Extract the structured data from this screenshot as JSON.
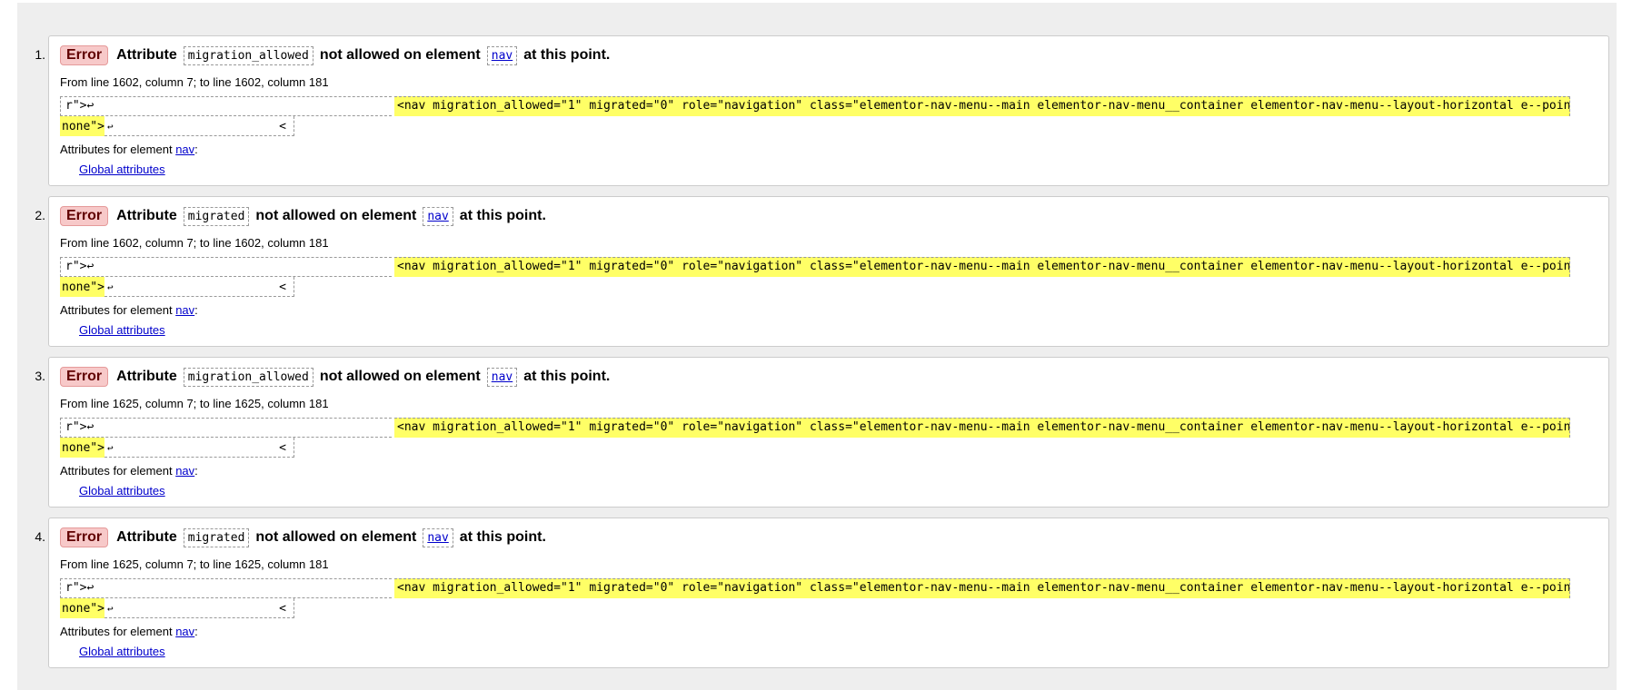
{
  "messages": [
    {
      "number": "1.",
      "type": "Error",
      "prefix": "Attribute",
      "attribute": "migration_allowed",
      "middle": "not allowed on element",
      "element": "nav",
      "suffix": "at this point.",
      "location": "From line 1602, column 7; to line 1602, column 181",
      "extract_pre": "r\">↩",
      "extract_highlight_line1": "<nav migration_allowed=\"1\" migrated=\"0\" role=\"navigation\" class=\"elementor-nav-menu--main elementor-nav-menu__container elementor-nav-menu--layout-horizontal e--pointer-",
      "extract_highlight_line2": "none\">",
      "extract_post": "↩",
      "extract_post_end": "<",
      "attrs_label": "Attributes for element",
      "attrs_element": "nav",
      "attrs_colon": ":",
      "global_link": "Global attributes"
    },
    {
      "number": "2.",
      "type": "Error",
      "prefix": "Attribute",
      "attribute": "migrated",
      "middle": "not allowed on element",
      "element": "nav",
      "suffix": "at this point.",
      "location": "From line 1602, column 7; to line 1602, column 181",
      "extract_pre": "r\">↩",
      "extract_highlight_line1": "<nav migration_allowed=\"1\" migrated=\"0\" role=\"navigation\" class=\"elementor-nav-menu--main elementor-nav-menu__container elementor-nav-menu--layout-horizontal e--pointer-",
      "extract_highlight_line2": "none\">",
      "extract_post": "↩",
      "extract_post_end": "<",
      "attrs_label": "Attributes for element",
      "attrs_element": "nav",
      "attrs_colon": ":",
      "global_link": "Global attributes"
    },
    {
      "number": "3.",
      "type": "Error",
      "prefix": "Attribute",
      "attribute": "migration_allowed",
      "middle": "not allowed on element",
      "element": "nav",
      "suffix": "at this point.",
      "location": "From line 1625, column 7; to line 1625, column 181",
      "extract_pre": "r\">↩",
      "extract_highlight_line1": "<nav migration_allowed=\"1\" migrated=\"0\" role=\"navigation\" class=\"elementor-nav-menu--main elementor-nav-menu__container elementor-nav-menu--layout-horizontal e--pointer-",
      "extract_highlight_line2": "none\">",
      "extract_post": "↩",
      "extract_post_end": "<",
      "attrs_label": "Attributes for element",
      "attrs_element": "nav",
      "attrs_colon": ":",
      "global_link": "Global attributes"
    },
    {
      "number": "4.",
      "type": "Error",
      "prefix": "Attribute",
      "attribute": "migrated",
      "middle": "not allowed on element",
      "element": "nav",
      "suffix": "at this point.",
      "location": "From line 1625, column 7; to line 1625, column 181",
      "extract_pre": "r\">↩",
      "extract_highlight_line1": "<nav migration_allowed=\"1\" migrated=\"0\" role=\"navigation\" class=\"elementor-nav-menu--main elementor-nav-menu__container elementor-nav-menu--layout-horizontal e--pointer-",
      "extract_highlight_line2": "none\">",
      "extract_post": "↩",
      "extract_post_end": "<",
      "attrs_label": "Attributes for element",
      "attrs_element": "nav",
      "attrs_colon": ":",
      "global_link": "Global attributes"
    }
  ],
  "colors": {
    "panel_background": "#eeeeee",
    "error_badge_background": "#f7c9c9",
    "highlight": "#ffff66",
    "link": "#0000cc"
  }
}
